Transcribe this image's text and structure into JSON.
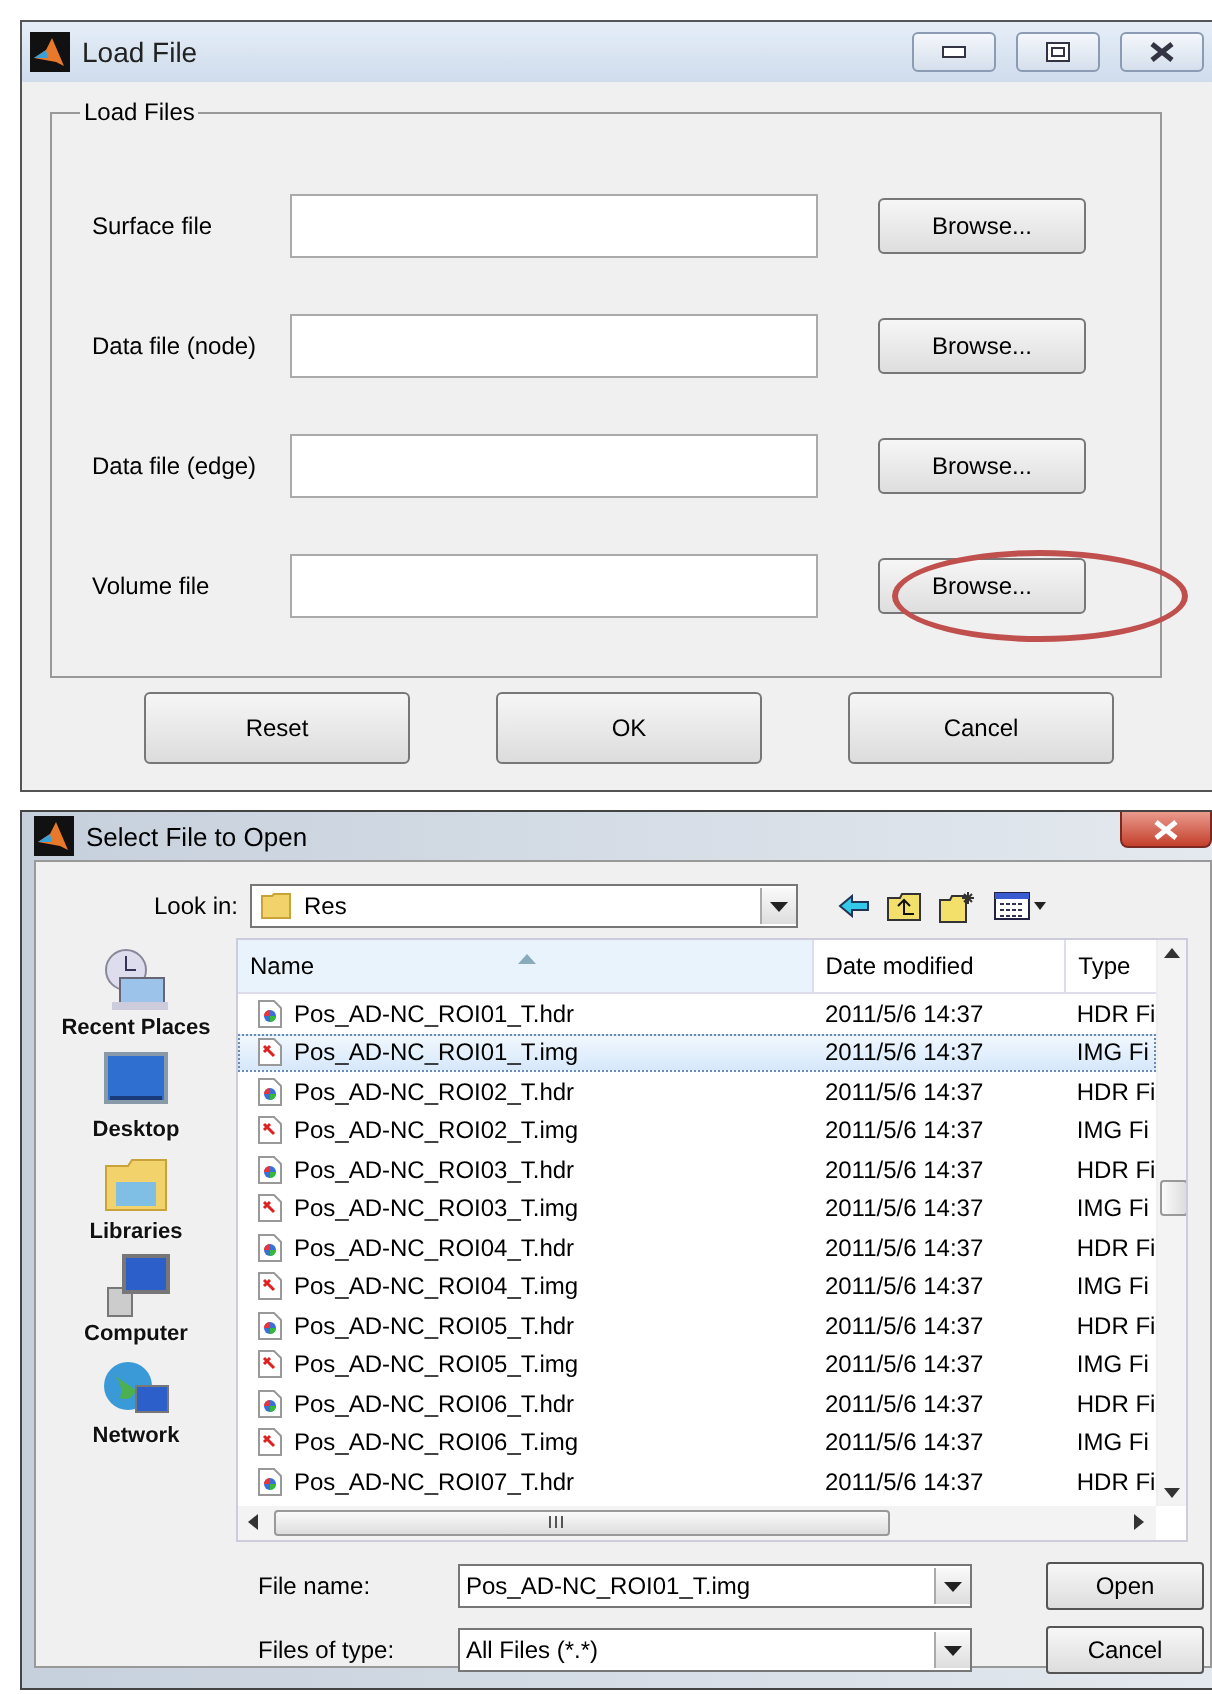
{
  "load_window": {
    "title": "Load File",
    "group_title": "Load Files",
    "rows": [
      {
        "label": "Surface file",
        "button": "Browse...",
        "circled": false
      },
      {
        "label": "Data file (node)",
        "button": "Browse...",
        "circled": false
      },
      {
        "label": "Data file (edge)",
        "button": "Browse...",
        "circled": false
      },
      {
        "label": "Volume file",
        "button": "Browse...",
        "circled": true
      }
    ],
    "buttons": [
      "Reset",
      "OK",
      "Cancel"
    ]
  },
  "open_dialog": {
    "title": "Select File to Open",
    "look_in": {
      "label": "Look in:",
      "value": "Res"
    },
    "places": [
      {
        "label": "Recent Places",
        "kind": "recent"
      },
      {
        "label": "Desktop",
        "kind": "desktop"
      },
      {
        "label": "Libraries",
        "kind": "libraries"
      },
      {
        "label": "Computer",
        "kind": "computer"
      },
      {
        "label": "Network",
        "kind": "network"
      }
    ],
    "columns": [
      "Name",
      "Date modified",
      "Type"
    ],
    "rows": [
      {
        "name": "Pos_AD-NC_ROI01_T.hdr",
        "date": "2011/5/6 14:37",
        "type": "HDR Fi",
        "kind": "hdr",
        "selected": false
      },
      {
        "name": "Pos_AD-NC_ROI01_T.img",
        "date": "2011/5/6 14:37",
        "type": "IMG Fi",
        "kind": "img",
        "selected": true
      },
      {
        "name": "Pos_AD-NC_ROI02_T.hdr",
        "date": "2011/5/6 14:37",
        "type": "HDR Fi",
        "kind": "hdr",
        "selected": false
      },
      {
        "name": "Pos_AD-NC_ROI02_T.img",
        "date": "2011/5/6 14:37",
        "type": "IMG Fi",
        "kind": "img",
        "selected": false
      },
      {
        "name": "Pos_AD-NC_ROI03_T.hdr",
        "date": "2011/5/6 14:37",
        "type": "HDR Fi",
        "kind": "hdr",
        "selected": false
      },
      {
        "name": "Pos_AD-NC_ROI03_T.img",
        "date": "2011/5/6 14:37",
        "type": "IMG Fi",
        "kind": "img",
        "selected": false
      },
      {
        "name": "Pos_AD-NC_ROI04_T.hdr",
        "date": "2011/5/6 14:37",
        "type": "HDR Fi",
        "kind": "hdr",
        "selected": false
      },
      {
        "name": "Pos_AD-NC_ROI04_T.img",
        "date": "2011/5/6 14:37",
        "type": "IMG Fi",
        "kind": "img",
        "selected": false
      },
      {
        "name": "Pos_AD-NC_ROI05_T.hdr",
        "date": "2011/5/6 14:37",
        "type": "HDR Fi",
        "kind": "hdr",
        "selected": false
      },
      {
        "name": "Pos_AD-NC_ROI05_T.img",
        "date": "2011/5/6 14:37",
        "type": "IMG Fi",
        "kind": "img",
        "selected": false
      },
      {
        "name": "Pos_AD-NC_ROI06_T.hdr",
        "date": "2011/5/6 14:37",
        "type": "HDR Fi",
        "kind": "hdr",
        "selected": false
      },
      {
        "name": "Pos_AD-NC_ROI06_T.img",
        "date": "2011/5/6 14:37",
        "type": "IMG Fi",
        "kind": "img",
        "selected": false
      },
      {
        "name": "Pos_AD-NC_ROI07_T.hdr",
        "date": "2011/5/6 14:37",
        "type": "HDR Fi",
        "kind": "hdr",
        "selected": false
      }
    ],
    "file_name": {
      "label": "File name:",
      "value": "Pos_AD-NC_ROI01_T.img"
    },
    "file_type": {
      "label": "Files of type:",
      "value": "All Files (*.*)"
    },
    "buttons": [
      "Open",
      "Cancel"
    ]
  }
}
